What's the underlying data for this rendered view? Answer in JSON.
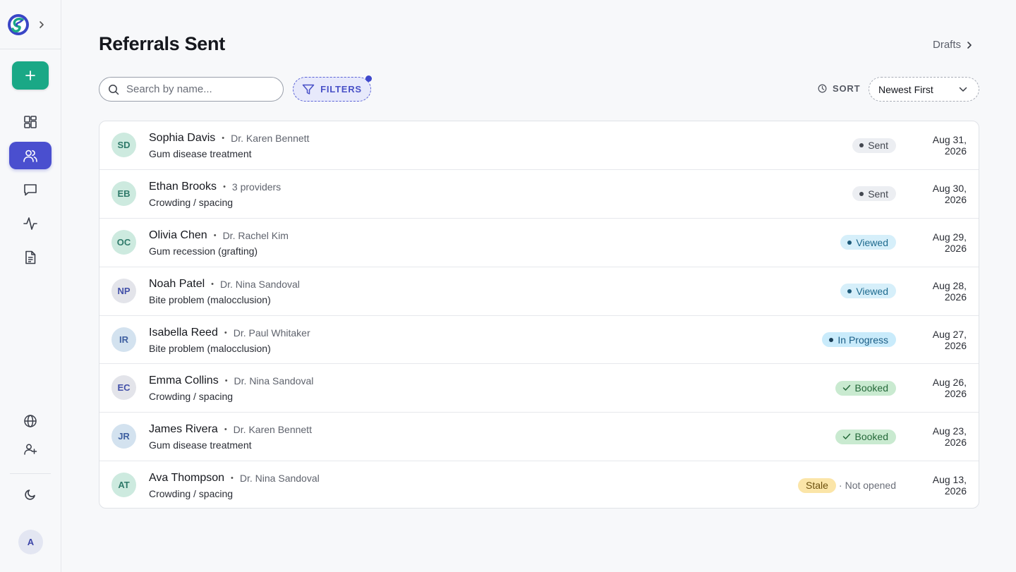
{
  "header": {
    "title": "Referrals Sent",
    "drafts_label": "Drafts"
  },
  "toolbar": {
    "search_placeholder": "Search by name...",
    "filters_label": "FILTERS",
    "sort_label": "SORT",
    "sort_value": "Newest First"
  },
  "sidebar": {
    "user_initial": "A"
  },
  "referrals": [
    {
      "initials": "SD",
      "name": "Sophia Davis",
      "provider": "Dr. Karen Bennett",
      "reason": "Gum disease treatment",
      "status": "Sent",
      "date": "Aug 31, 2026"
    },
    {
      "initials": "EB",
      "name": "Ethan Brooks",
      "provider": "3 providers",
      "reason": "Crowding / spacing",
      "status": "Sent",
      "date": "Aug 30, 2026"
    },
    {
      "initials": "OC",
      "name": "Olivia Chen",
      "provider": "Dr. Rachel Kim",
      "reason": "Gum recession (grafting)",
      "status": "Viewed",
      "date": "Aug 29, 2026"
    },
    {
      "initials": "NP",
      "name": "Noah Patel",
      "provider": "Dr. Nina Sandoval",
      "reason": "Bite problem (malocclusion)",
      "status": "Viewed",
      "date": "Aug 28, 2026"
    },
    {
      "initials": "IR",
      "name": "Isabella Reed",
      "provider": "Dr. Paul Whitaker",
      "reason": "Bite problem (malocclusion)",
      "status": "In Progress",
      "date": "Aug 27, 2026"
    },
    {
      "initials": "EC",
      "name": "Emma Collins",
      "provider": "Dr. Nina Sandoval",
      "reason": "Crowding / spacing",
      "status": "Booked",
      "date": "Aug 26, 2026"
    },
    {
      "initials": "JR",
      "name": "James Rivera",
      "provider": "Dr. Karen Bennett",
      "reason": "Gum disease treatment",
      "status": "Booked",
      "date": "Aug 23, 2026"
    },
    {
      "initials": "AT",
      "name": "Ava Thompson",
      "provider": "Dr. Nina Sandoval",
      "reason": "Crowding / spacing",
      "status": "Stale",
      "status_note": "Not opened",
      "date": "Aug 13, 2026"
    }
  ],
  "colors": {
    "accent": "#4a4fcf",
    "new_button": "#1aa886",
    "avatar_green_bg": "#cdeadf",
    "avatar_green_fg": "#2f7a6a",
    "avatar_blue_bg": "#d3e2ef",
    "avatar_blue_fg": "#3e5fa0",
    "avatar_gray_bg": "#e3e4ea",
    "avatar_gray_fg": "#4250a8"
  }
}
